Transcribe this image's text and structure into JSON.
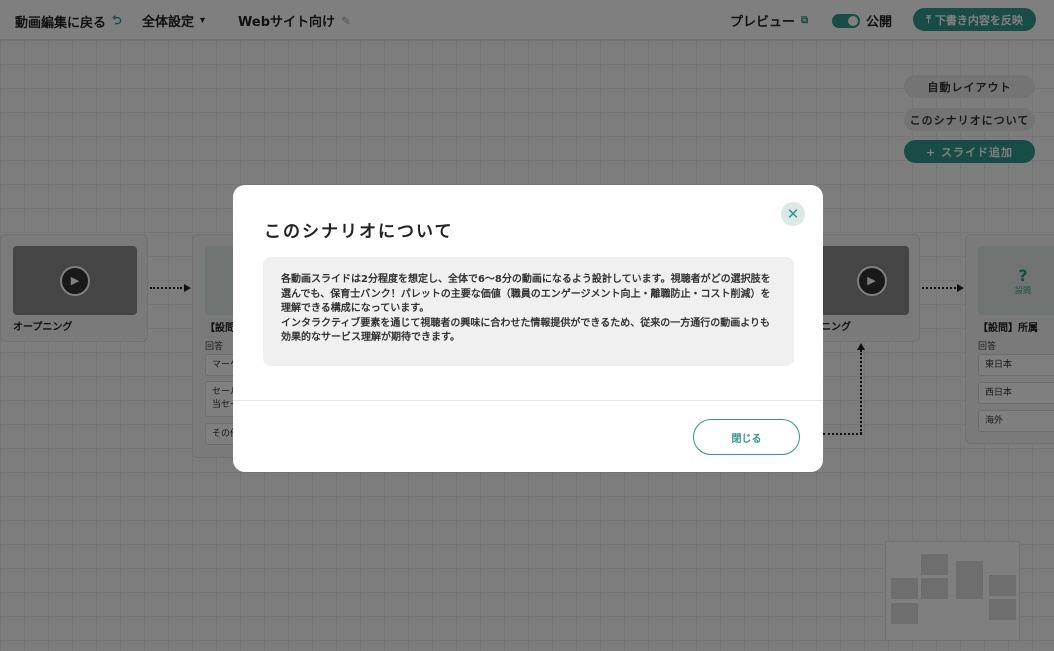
{
  "topbar": {
    "back_label": "動画編集に戻る",
    "settings_label": "全体設定",
    "project_name": "Webサイト向け",
    "preview_label": "プレビュー",
    "publish_label": "公開",
    "reflect_label": "下書き内容を反映"
  },
  "side_buttons": {
    "auto_layout": "自動レイアウト",
    "about_scenario": "このシナリオについて",
    "add_slide": "+ スライド追加"
  },
  "cards": {
    "opening_title": "オープニング",
    "q1_title": "【設問",
    "q1_answer_label": "回答",
    "q1_ans1": "マーケ",
    "q1_ans2a": "セール",
    "q1_ans2b": "当セー",
    "q1_ans3": "その他",
    "ending_title": "ニング",
    "q2_title": "【設問】所属",
    "q2_answer_label": "回答",
    "q2_icon_label": "設問",
    "q2_ans1": "東日本",
    "q2_ans2": "西日本",
    "q2_ans3": "海外"
  },
  "modal": {
    "title": "このシナリオについて",
    "body_p1": "各動画スライドは2分程度を想定し、全体で6〜8分の動画になるよう設計しています。視聴者がどの選択肢を選んでも、保育士バンク！パレットの主要な価値（職員のエンゲージメント向上・離職防止・コスト削減）を理解できる構成になっています。",
    "body_p2": "インタラクティブ要素を通じて視聴者の興味に合わせた情報提供ができるため、従来の一方通行の動画よりも効果的なサービス理解が期待できます。",
    "close_label": "閉じる"
  },
  "colors": {
    "accent": "#2f9a88"
  },
  "icons": {
    "back": "undo-arrow-icon",
    "settings": "chevron-down-icon",
    "edit": "pencil-icon",
    "preview": "external-link-icon",
    "reflect": "upload-icon",
    "close": "close-icon",
    "play": "play-icon",
    "question": "question-icon"
  }
}
